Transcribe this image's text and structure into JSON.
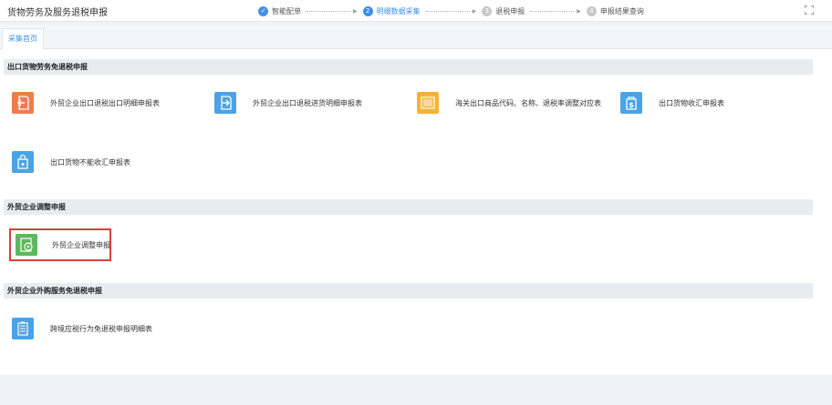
{
  "header": {
    "title": "货物劳务及服务退税申报",
    "steps": [
      {
        "number": "✓",
        "label": "智能配单",
        "state": "done"
      },
      {
        "number": "2",
        "label": "明细数据采集",
        "state": "active"
      },
      {
        "number": "3",
        "label": "退税申报",
        "state": "pending"
      },
      {
        "number": "4",
        "label": "申报结果查询",
        "state": "pending"
      }
    ],
    "expand_icon": "fullscreen-icon"
  },
  "tabs": [
    {
      "label": "采集首页",
      "active": true
    }
  ],
  "sections": [
    {
      "title": "出口货物劳务免退税申报",
      "items": [
        {
          "label": "外贸企业出口退税出口明细申报表",
          "icon": "export-arrow-icon",
          "color": "#f07b4f"
        },
        {
          "label": "外贸企业出口退税进货明细申报表",
          "icon": "import-arrow-icon",
          "color": "#4aa3e6"
        },
        {
          "label": "海关出口商品代码、名称、退税率调整对应表",
          "icon": "barcode-icon",
          "color": "#f5b335"
        },
        {
          "label": "出口货物收汇申报表",
          "icon": "money-bag-icon",
          "color": "#4aa3e6"
        },
        {
          "label": "出口货物不能收汇申报表",
          "icon": "lock-bag-icon",
          "color": "#4aa3e6"
        }
      ]
    },
    {
      "title": "外贸企业调整申报",
      "items": [
        {
          "label": "外贸企业调整申报",
          "icon": "adjust-report-icon",
          "color": "#5cb85c"
        }
      ]
    },
    {
      "title": "外贸企业外购服务免退税申报",
      "items": [
        {
          "label": "跨境应税行为免退税申报明细表",
          "icon": "document-list-icon",
          "color": "#4aa3e6"
        }
      ]
    }
  ]
}
